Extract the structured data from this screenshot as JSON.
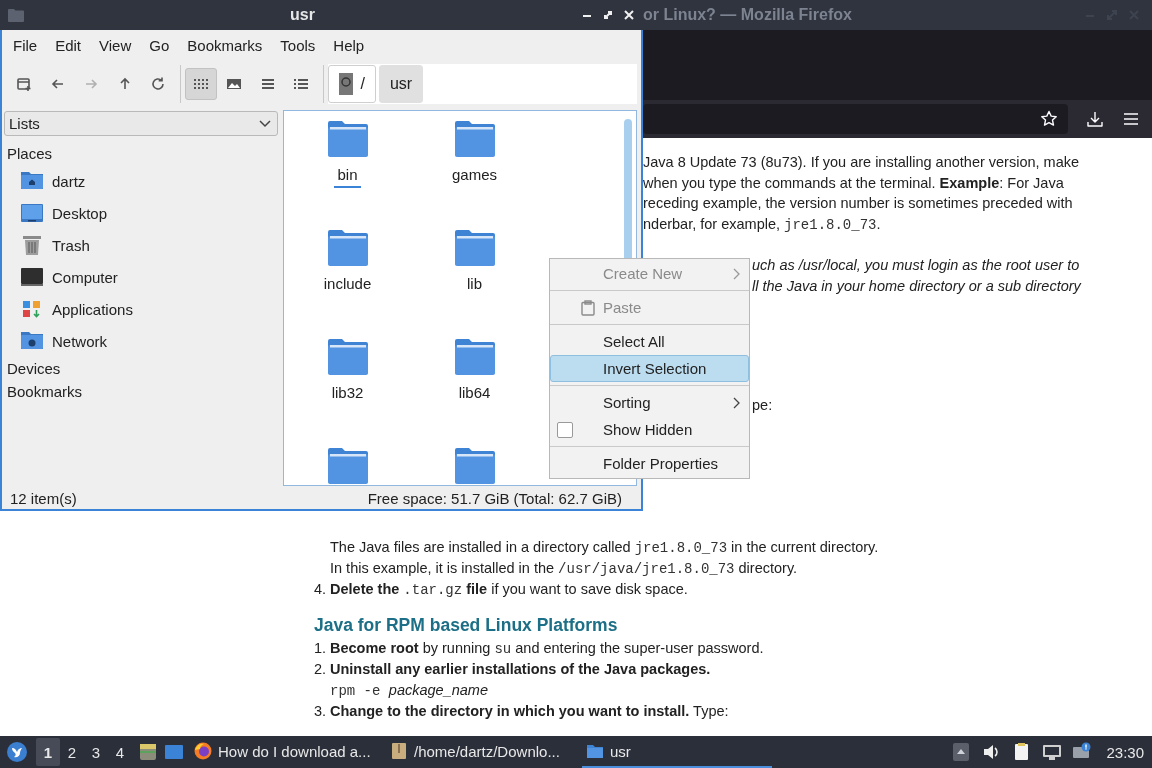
{
  "firefox": {
    "title": "or Linux? — Mozilla Firefox",
    "upper_lines": [
      [
        {
          "kind": "text",
          "text": "Java 8 Update 73 (8u73). If you are installing another version, make"
        }
      ],
      [
        {
          "kind": "text",
          "text": "when you type the commands at the terminal. **Example**: For Java"
        }
      ],
      [
        {
          "kind": "text",
          "text": "receding example, the version number is sometimes preceded with"
        }
      ],
      [
        {
          "kind": "text",
          "text": "nderbar, for example, "
        },
        {
          "kind": "code",
          "text": "jre1.8.0_73"
        },
        {
          "kind": "text",
          "text": "."
        }
      ]
    ],
    "note_lines": [
      "uch as /usr/local, you must login as the root user to",
      "ll the Java in your home directory or a sub directory"
    ],
    "fragment": "pe:",
    "lower": [
      {
        "kind": "continuation",
        "segments": [
          {
            "kind": "text",
            "text": "The Java files are installed in a directory called "
          },
          {
            "kind": "code",
            "text": "jre1.8.0_73"
          },
          {
            "kind": "text",
            "text": " in the current directory."
          }
        ]
      },
      {
        "kind": "continuation",
        "segments": [
          {
            "kind": "text",
            "text": "In this example, it is installed in the "
          },
          {
            "kind": "code",
            "text": "/usr/java/jre1.8.0_73"
          },
          {
            "kind": "text",
            "text": " directory."
          }
        ]
      },
      {
        "kind": "step",
        "num": "4.",
        "segments": [
          {
            "kind": "text",
            "text": "**Delete the** "
          },
          {
            "kind": "code",
            "text": ".tar.gz"
          },
          {
            "kind": "text",
            "text": " **file** if you want to save disk space."
          }
        ]
      },
      {
        "kind": "heading",
        "text": "Java for RPM based Linux Platforms"
      },
      {
        "kind": "step",
        "num": "1.",
        "segments": [
          {
            "kind": "text",
            "text": "**Become root** by running "
          },
          {
            "kind": "code",
            "text": "su"
          },
          {
            "kind": "text",
            "text": " and entering the super-user password."
          }
        ]
      },
      {
        "kind": "step",
        "num": "2.",
        "segments": [
          {
            "kind": "text",
            "text": "**Uninstall any earlier installations of the Java packages.**"
          }
        ]
      },
      {
        "kind": "continuation",
        "segments": [
          {
            "kind": "code",
            "text": "rpm -e "
          },
          {
            "kind": "text",
            "text": "*package_name*"
          }
        ]
      },
      {
        "kind": "step",
        "num": "3.",
        "segments": [
          {
            "kind": "text",
            "text": "**Change to the directory in which you want to install.** Type:"
          }
        ]
      }
    ]
  },
  "file_manager": {
    "title": "usr",
    "menu": [
      "File",
      "Edit",
      "View",
      "Go",
      "Bookmarks",
      "Tools",
      "Help"
    ],
    "nav": [
      {
        "kind": "new-tab",
        "disabled": false
      },
      {
        "kind": "back",
        "disabled": false
      },
      {
        "kind": "forward",
        "disabled": true
      },
      {
        "kind": "up",
        "disabled": false
      },
      {
        "kind": "reload",
        "disabled": false
      }
    ],
    "views": [
      {
        "kind": "icons",
        "selected": true
      },
      {
        "kind": "thumbnails",
        "selected": false
      },
      {
        "kind": "compact",
        "selected": false
      },
      {
        "kind": "details",
        "selected": false
      }
    ],
    "path": [
      {
        "kind": "root",
        "label": "/",
        "selected": false
      },
      {
        "kind": "folder",
        "label": "usr",
        "selected": true
      }
    ],
    "side_panel": {
      "mode": "Lists",
      "sections": [
        {
          "title": "Places",
          "items": [
            {
              "kind": "home",
              "label": "dartz"
            },
            {
              "kind": "desktop",
              "label": "Desktop"
            },
            {
              "kind": "trash",
              "label": "Trash"
            },
            {
              "kind": "computer",
              "label": "Computer"
            },
            {
              "kind": "applications",
              "label": "Applications"
            },
            {
              "kind": "network",
              "label": "Network"
            }
          ]
        },
        {
          "title": "Devices"
        },
        {
          "title": "Bookmarks"
        }
      ]
    },
    "files": [
      {
        "kind": "folder",
        "name": "bin",
        "focused": true
      },
      {
        "kind": "folder",
        "name": "games",
        "focused": false
      },
      {
        "kind": "folder",
        "name": "include",
        "focused": false
      },
      {
        "kind": "folder",
        "name": "lib",
        "focused": false
      },
      {
        "kind": "folder",
        "name": "lib32",
        "focused": false
      },
      {
        "kind": "folder",
        "name": "lib64",
        "focused": false
      },
      {
        "kind": "folder"
      },
      {
        "kind": "folder"
      }
    ],
    "status": {
      "count": "12 item(s)",
      "free_space": "Free space: 51.7 GiB (Total: 62.7 GiB)"
    }
  },
  "context_menu": {
    "items": [
      {
        "kind": "submenu",
        "label": "Create New",
        "disabled": true,
        "selected": false
      },
      {
        "kind": "separator"
      },
      {
        "kind": "paste",
        "label": "Paste",
        "disabled": true,
        "selected": false
      },
      {
        "kind": "separator"
      },
      {
        "kind": "action",
        "label": "Select All",
        "disabled": false,
        "selected": false
      },
      {
        "kind": "action",
        "label": "Invert Selection",
        "disabled": false,
        "selected": true
      },
      {
        "kind": "separator"
      },
      {
        "kind": "submenu",
        "label": "Sorting",
        "disabled": false,
        "selected": false
      },
      {
        "kind": "checkbox",
        "label": "Show Hidden",
        "checked": false,
        "disabled": false,
        "selected": false
      },
      {
        "kind": "separator"
      },
      {
        "kind": "action",
        "label": "Folder Properties",
        "disabled": false,
        "selected": false
      }
    ]
  },
  "taskbar": {
    "workspaces": [
      {
        "label": "1",
        "selected": true
      },
      {
        "label": "2",
        "selected": false
      },
      {
        "label": "3",
        "selected": false
      },
      {
        "label": "4",
        "selected": false
      }
    ],
    "launchers": [
      {
        "kind": "files"
      },
      {
        "kind": "desktop"
      }
    ],
    "tasks": [
      {
        "kind": "firefox",
        "label": "How do I download a...",
        "selected": false
      },
      {
        "kind": "archive",
        "label": "/home/dartz/Downlo...",
        "selected": false
      },
      {
        "kind": "folder",
        "label": "usr",
        "selected": true
      }
    ],
    "tray": [
      {
        "kind": "up"
      },
      {
        "kind": "volume"
      },
      {
        "kind": "clipboard"
      },
      {
        "kind": "network"
      },
      {
        "kind": "notification"
      }
    ],
    "clock": "23:30"
  }
}
